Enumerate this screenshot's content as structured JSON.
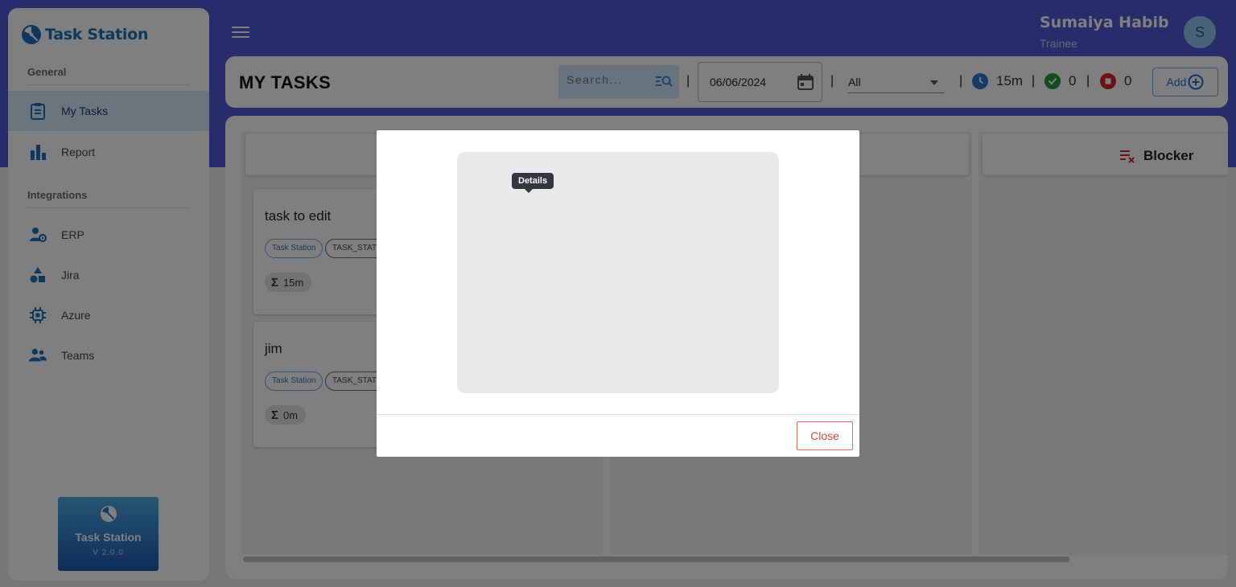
{
  "brand": {
    "name": "Task Station"
  },
  "sidebar": {
    "sections": [
      {
        "label": "General"
      },
      {
        "label": "Integrations"
      }
    ],
    "items": [
      {
        "label": "My Tasks",
        "icon": "clipboard-icon",
        "active": true
      },
      {
        "label": "Report",
        "icon": "bar-chart-icon"
      },
      {
        "label": "ERP",
        "icon": "erp-icon"
      },
      {
        "label": "Jira",
        "icon": "jira-icon"
      },
      {
        "label": "Azure",
        "icon": "azure-chip-icon"
      },
      {
        "label": "Teams",
        "icon": "teams-icon"
      }
    ],
    "promo": {
      "title": "Task Station",
      "version": "V 2.0.0"
    }
  },
  "user": {
    "name": "Sumaiya Habib",
    "role": "Trainee",
    "initial": "S"
  },
  "toolbar": {
    "title": "MY TASKS",
    "search_placeholder": "Search...",
    "date": "06/06/2024",
    "filter": "All",
    "separator": "|",
    "stats": {
      "time": "15m",
      "done": "0",
      "blocked": "0"
    },
    "add_label": "Add"
  },
  "board": {
    "columns": [
      {
        "title": ""
      },
      {
        "title": ""
      },
      {
        "title": "Blocker"
      }
    ],
    "cards": [
      {
        "title": "task to edit",
        "project": "Task Station",
        "key": "TASK_STATIO",
        "duration": "15m"
      },
      {
        "title": "jim",
        "project": "Task Station",
        "key": "TASK_STATIO",
        "duration": "0m"
      }
    ]
  },
  "modal": {
    "tooltip": "Details",
    "close_label": "Close"
  },
  "colors": {
    "header": "#4f5bd5",
    "brand_blue": "#1a73b8",
    "active_nav": "#d4ebfb",
    "close_red": "#d84a3e",
    "done_green": "#1f9d3a",
    "blocked_red": "#d8262a",
    "time_blue": "#2a78c8"
  }
}
